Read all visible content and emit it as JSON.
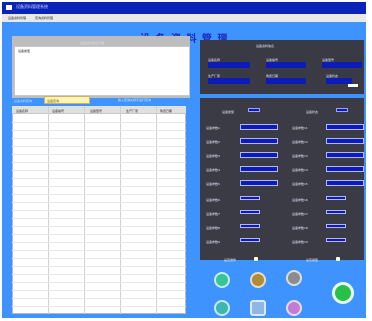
{
  "window": {
    "title": "设备资料管理系统"
  },
  "menu": {
    "items": [
      "设备资料管理",
      "查询资料管理"
    ]
  },
  "header": {
    "title": "设 备 资 料 管 理"
  },
  "left_panel": {
    "title": "设备资料信息管理",
    "content_text": "设备类型"
  },
  "search": {
    "label": "设备资料查询",
    "value": "设备查询",
    "hint": "输入查询关键字进行查询"
  },
  "table": {
    "columns": [
      "设备名称",
      "设备编号",
      "设备型号",
      "生产厂家",
      "购置日期"
    ]
  },
  "right_top": {
    "title": "设备资料信息",
    "labels": [
      "设备名称",
      "设备编号",
      "设备型号",
      "生产厂家",
      "购置日期",
      "设备状态"
    ]
  },
  "right_main": {
    "toggles": [
      "设备类型",
      "设备状态"
    ],
    "left_labels": [
      "设备参数1",
      "设备参数2",
      "设备参数3",
      "设备参数4",
      "设备参数5",
      "设备参数6",
      "设备参数7",
      "设备参数8",
      "设备参数9",
      "设备参数10"
    ],
    "right_labels": [
      "设备参数11",
      "设备参数12",
      "设备参数13",
      "设备参数14",
      "设备参数15",
      "设备参数16",
      "设备参数17",
      "设备参数18",
      "设备参数19",
      "设备参数20"
    ]
  },
  "bottom": {
    "left_check_label": "是否维修",
    "right_check_label": "是否报废"
  },
  "buttons": {
    "icons": [
      "refresh-icon",
      "open-folder-icon",
      "print-icon",
      "tools-icon",
      "document-icon",
      "delete-icon",
      "exit-icon"
    ]
  }
}
